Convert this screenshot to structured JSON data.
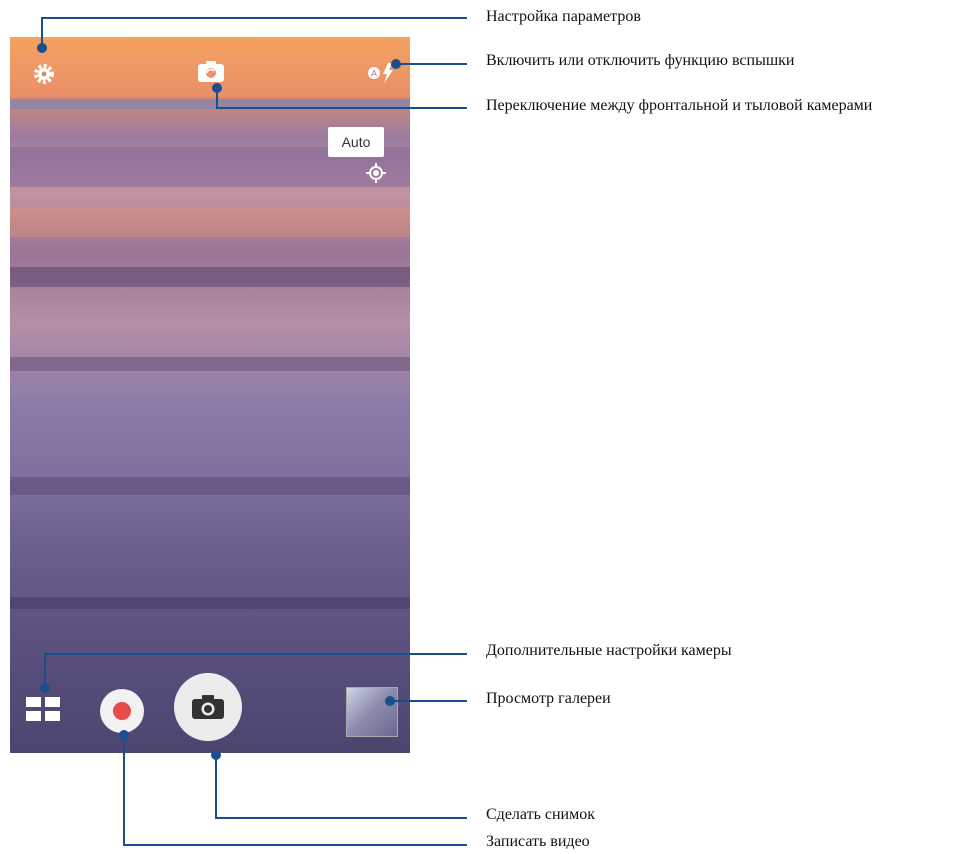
{
  "camera_ui": {
    "auto_button": "Auto",
    "icons": {
      "settings": "settings-gear-icon",
      "switch_camera": "switch-camera-icon",
      "flash": "flash-auto-icon",
      "focus": "focus-target-icon",
      "modes": "modes-grid-icon",
      "record": "record-video-icon",
      "shutter": "camera-shutter-icon",
      "gallery": "gallery-thumbnail"
    },
    "colors": {
      "record": "#e84b4b",
      "accent_line": "#1a4f8f"
    }
  },
  "callouts": {
    "settings": "Настройка параметров",
    "flash": "Включить или отключить функцию вспышки",
    "switch_camera": "Переключение между фронтальной и тыловой камерами",
    "more_settings": "Дополнительные настройки камеры",
    "gallery": "Просмотр галереи",
    "take_photo": "Сделать снимок",
    "record_video": "Записать видео"
  }
}
